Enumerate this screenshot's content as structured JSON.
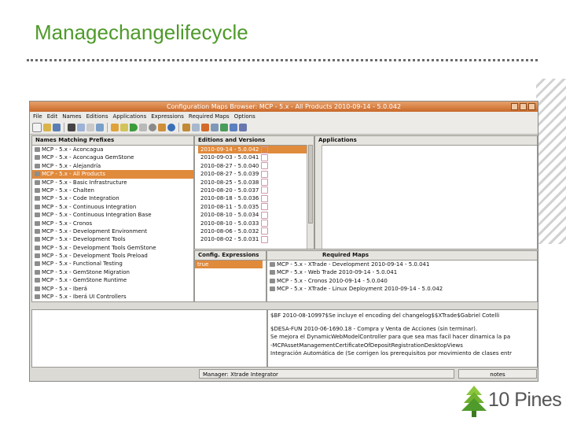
{
  "slide": {
    "title": "Managechangelifecycle",
    "logo_text": "10 Pines",
    "accent_color": "#4e9a2a"
  },
  "window": {
    "title": "Configuration Maps Browser: MCP - 5.x - All Products 2010-09-14 - 5.0.042",
    "menu": [
      "File",
      "Edit",
      "Names",
      "Editions",
      "Applications",
      "Expressions",
      "Required Maps",
      "Options"
    ]
  },
  "names_panel": {
    "header": "Names Matching Prefixes",
    "selected_index": 3,
    "items": [
      "MCP - 5.x - Aconcagua",
      "MCP - 5.x - Aconcagua GemStone",
      "MCP - 5.x - Alejandría",
      "MCP - 5.x - All Products",
      "MCP - 5.x - Basic Infrastructure",
      "MCP - 5.x - Chalten",
      "MCP - 5.x - Code Integration",
      "MCP - 5.x - Continuous Integration",
      "MCP - 5.x - Continuous Integration Base",
      "MCP - 5.x - Cronos",
      "MCP - 5.x - Development Environment",
      "MCP - 5.x - Development Tools",
      "MCP - 5.x - Development Tools GemStone",
      "MCP - 5.x - Development Tools Preload",
      "MCP - 5.x - Functional Testing",
      "MCP - 5.x - GemStone Migration",
      "MCP - 5.x - GemStone Runtime",
      "MCP - 5.x - Iberá",
      "MCP - 5.x - Iberá UI Controllers"
    ]
  },
  "editions_panel": {
    "header": "Editions and Versions",
    "selected_index": 0,
    "items": [
      "2010-09-14 - 5.0.042",
      "2010-09-03 - 5.0.041",
      "2010-08-27 - 5.0.040",
      "2010-08-27 - 5.0.039",
      "2010-08-25 - 5.0.038",
      "2010-08-20 - 5.0.037",
      "2010-08-18 - 5.0.036",
      "2010-08-11 - 5.0.035",
      "2010-08-10 - 5.0.034",
      "2010-08-10 - 5.0.033",
      "2010-08-06 - 5.0.032",
      "2010-08-02 - 5.0.031"
    ]
  },
  "applications_panel": {
    "header": "Applications"
  },
  "config_panel": {
    "header": "Config. Expressions",
    "items": [
      "true"
    ]
  },
  "required_panel": {
    "header": "Required Maps",
    "items": [
      "MCP - 5.x - XTrade - Development 2010-09-14 - 5.0.041",
      "MCP - 5.x - Web Trade 2010-09-14 - 5.0.041",
      "MCP - 5.x - Cronos 2010-09-14 - 5.0.040",
      "MCP - 5.x - XTrade - Linux Deployment 2010-09-14 - 5.0.042"
    ]
  },
  "notes_panel": {
    "lines": [
      "$BF 2010-08-10997$Se incluye el encoding del changelog$$XTrade$Gabriel Cotelli",
      "",
      "$DESA-FUN 2010-06-1690.18 - Compra y Venta de Acciones (sin terminar).",
      "Se mejora el DynamicWebModelController para que sea mas facil hacer dinamica la pa",
      "-MCPAssetManagementCertificateOfDepositRegistrationDesktopViews",
      "Integración Automática de (Se corrigen los prerequisitos por movimiento de clases entr"
    ]
  },
  "status": {
    "manager": "Manager: Xtrade Integrator",
    "notes": "notes"
  }
}
